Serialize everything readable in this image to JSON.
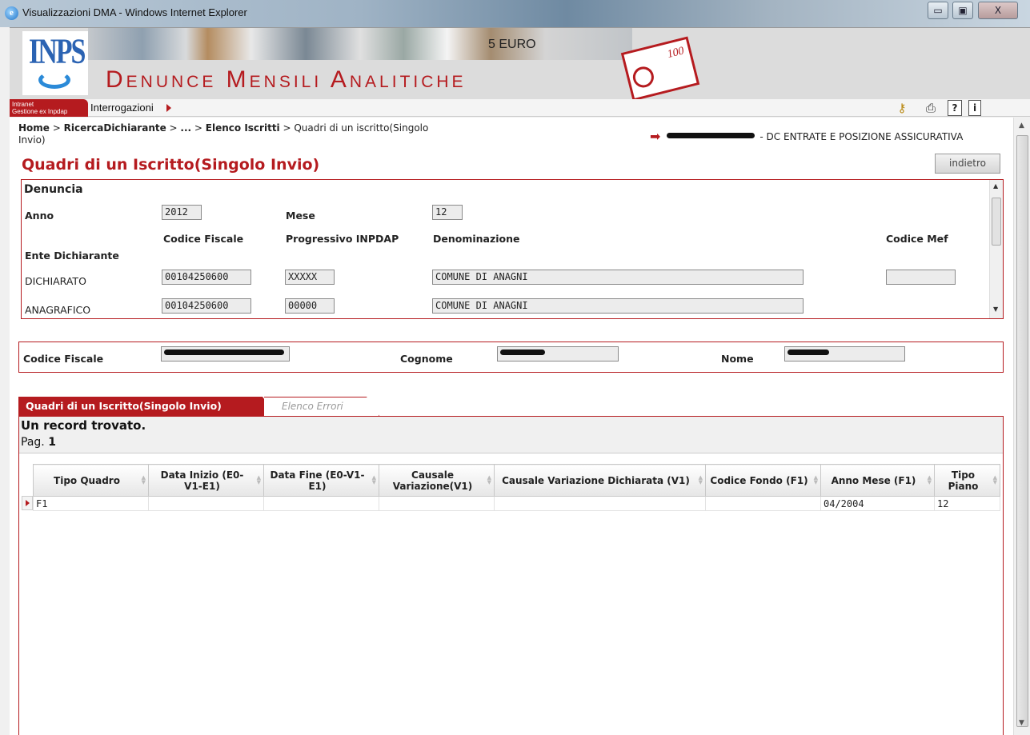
{
  "window": {
    "title": "Visualizzazioni DMA - Windows Internet Explorer",
    "minimize": "▭",
    "maximize": "▣",
    "close": "X"
  },
  "header": {
    "logo_text": "INPS",
    "banner_title": "Denunce Mensili Analitiche",
    "euro_text": "5 EURO",
    "banknote_value": "100"
  },
  "menubar": {
    "intranet_line1": "Intranet",
    "intranet_line2": "Gestione ex Inpdap",
    "menu_item": "Interrogazioni",
    "icons": [
      "key-icon",
      "print-icon",
      "help-icon",
      "info-icon"
    ]
  },
  "breadcrumb": {
    "home": "Home",
    "ricerca": "RicercaDichiarante",
    "ellipsis": "...",
    "elenco": "Elenco Iscritti",
    "current": "Quadri di un iscritto(Singolo Invio)"
  },
  "user": {
    "office": "- DC ENTRATE E POSIZIONE ASSICURATIVA"
  },
  "page": {
    "title": "Quadri di un Iscritto(Singolo Invio)",
    "back_button": "indietro"
  },
  "denuncia": {
    "heading": "Denuncia",
    "anno_label": "Anno",
    "anno_value": "2012",
    "mese_label": "Mese",
    "mese_value": "12",
    "col_codice_fiscale": "Codice Fiscale",
    "col_progressivo": "Progressivo INPDAP",
    "col_denominazione": "Denominazione",
    "col_codice_mef": "Codice Mef",
    "ente_label": "Ente Dichiarante",
    "rows": [
      {
        "label": "DICHIARATO",
        "codice_fiscale": "00104250600",
        "progressivo": "XXXXX",
        "denominazione": "COMUNE DI ANAGNI",
        "codice_mef": ""
      },
      {
        "label": "ANAGRAFICO",
        "codice_fiscale": "00104250600",
        "progressivo": "00000",
        "denominazione": "COMUNE DI ANAGNI"
      }
    ]
  },
  "person": {
    "codice_fiscale_label": "Codice Fiscale",
    "cognome_label": "Cognome",
    "nome_label": "Nome"
  },
  "tabs": {
    "active": "Quadri di un Iscritto(Singolo Invio)",
    "inactive": "Elenco Errori"
  },
  "records": {
    "found": "Un record trovato.",
    "page_label": "Pag.",
    "page_number": "1"
  },
  "grid": {
    "columns": [
      "Tipo Quadro",
      "Data Inizio (E0-V1-E1)",
      "Data Fine (E0-V1-E1)",
      "Causale Variazione(V1)",
      "Causale Variazione Dichiarata (V1)",
      "Codice Fondo (F1)",
      "Anno Mese (F1)",
      "Tipo Piano"
    ],
    "rows": [
      [
        "F1",
        "",
        "",
        "",
        "",
        "",
        "04/2004",
        "12"
      ]
    ]
  }
}
